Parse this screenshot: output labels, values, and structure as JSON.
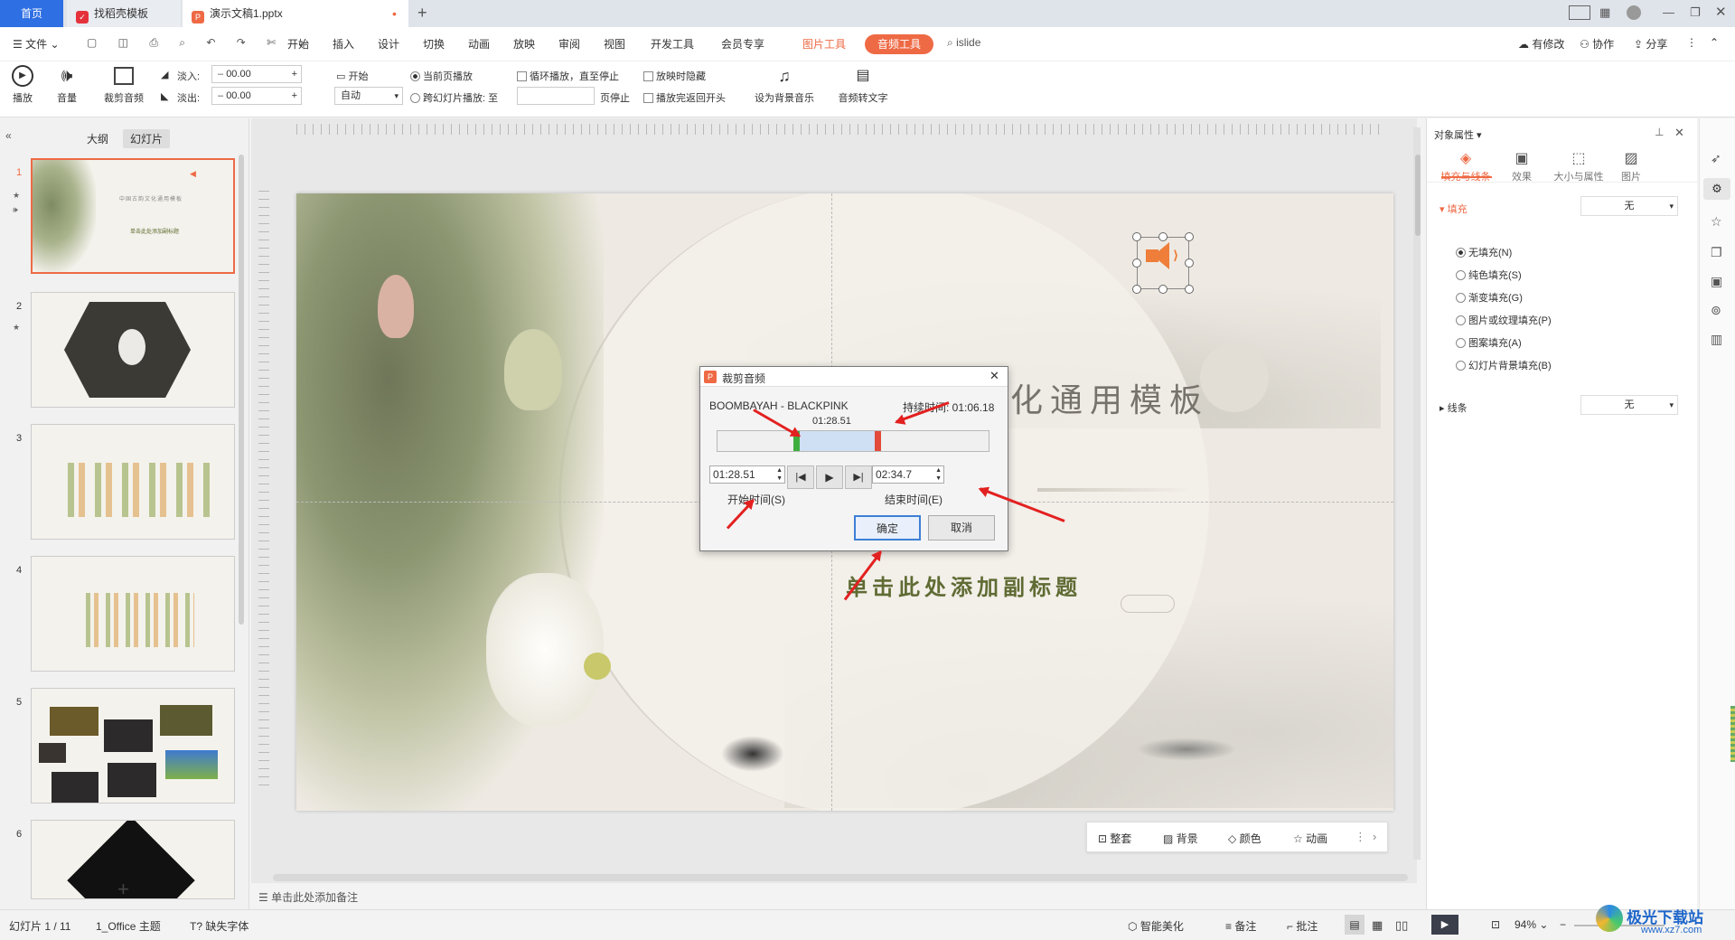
{
  "tabs": {
    "home": "首页",
    "template": "找稻壳模板",
    "document": "演示文稿1.pptx"
  },
  "menu": {
    "file": "文件",
    "items": [
      "开始",
      "插入",
      "设计",
      "切换",
      "动画",
      "放映",
      "审阅",
      "视图",
      "开发工具",
      "会员专享"
    ],
    "picture_tools": "图片工具",
    "audio_tools": "音频工具",
    "search": "islide",
    "right": [
      "有修改",
      "协作",
      "分享"
    ]
  },
  "ribbon": {
    "play": "播放",
    "volume": "音量",
    "trim": "裁剪音频",
    "fade_in_label": "淡入:",
    "fade_in_value": "00.00",
    "fade_out_label": "淡出:",
    "fade_out_value": "00.00",
    "start_label": "开始",
    "start_value": "自动",
    "current_page": "当前页播放",
    "cross_slide": "跨幻灯片播放: 至",
    "page_stop": "页停止",
    "loop": "循环播放，直至停止",
    "hide_on_show": "放映时隐藏",
    "rewind": "播放完返回开头",
    "bg_music": "设为背景音乐",
    "to_text": "音频转文字"
  },
  "left_panel": {
    "tab_outline": "大纲",
    "tab_slides": "幻灯片",
    "slide_numbers": [
      "1",
      "2",
      "3",
      "4",
      "5",
      "6"
    ],
    "slide1_title": "中国古韵文化通用模板",
    "slide1_sub": "单击此处添加副标题",
    "add": "+"
  },
  "slide": {
    "title": "化通用模板",
    "subtitle": "单击此处添加副标题"
  },
  "dialog": {
    "title": "裁剪音频",
    "song": "BOOMBAYAH - BLACKPINK",
    "duration_label": "持续时间: 01:06.18",
    "marker_time": "01:28.51",
    "start_value": "01:28.51",
    "end_value": "02:34.7",
    "start_label": "开始时间(S)",
    "end_label": "结束时间(E)",
    "ok": "确定",
    "cancel": "取消"
  },
  "float_toolbar": [
    "整套",
    "背景",
    "颜色",
    "动画"
  ],
  "notes": "单击此处添加备注",
  "right_panel": {
    "header": "对象属性",
    "tabs": [
      "填充与线条",
      "效果",
      "大小与属性",
      "图片"
    ],
    "fill_section": "填充",
    "fill_value": "无",
    "options": [
      "无填充(N)",
      "纯色填充(S)",
      "渐变填充(G)",
      "图片或纹理填充(P)",
      "图案填充(A)",
      "幻灯片背景填充(B)"
    ],
    "line_section": "线条",
    "line_value": "无"
  },
  "status": {
    "slide_count": "幻灯片 1 / 11",
    "theme": "1_Office 主题",
    "missing_font": "缺失字体",
    "smart": "智能美化",
    "notes": "备注",
    "comments": "批注",
    "zoom": "94%"
  },
  "watermark": {
    "brand": "极光下载站",
    "url": "www.xz7.com"
  },
  "colors": {
    "accent": "#ee6a45",
    "primary": "#2f6fe4",
    "arrow": "#e32020"
  }
}
